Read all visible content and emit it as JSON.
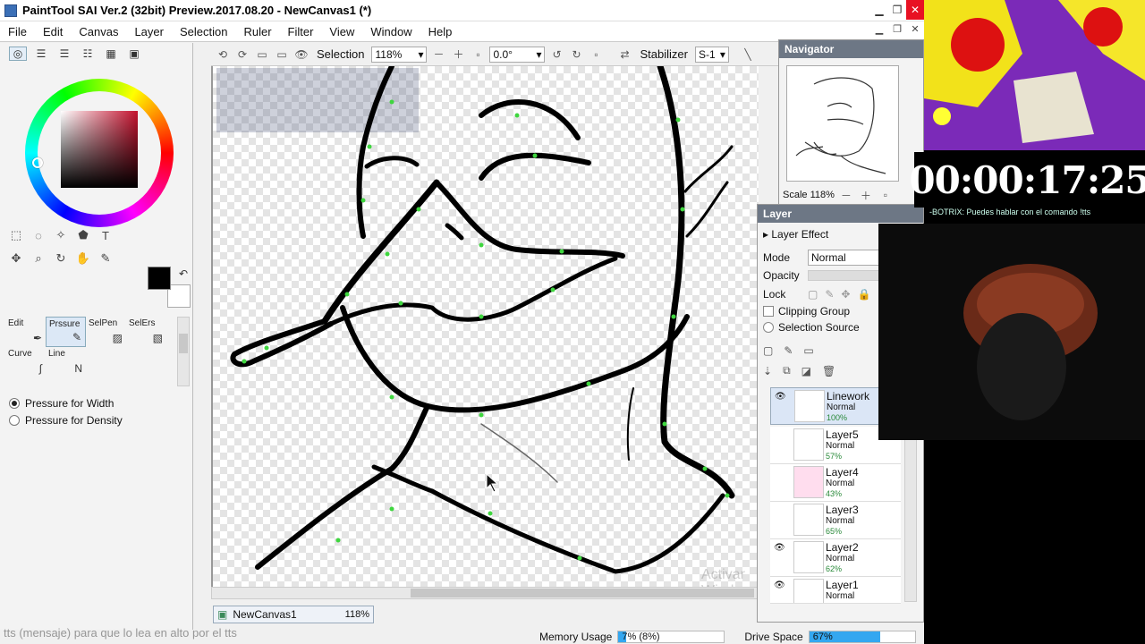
{
  "window": {
    "title": "PaintTool SAI Ver.2 (32bit) Preview.2017.08.20 - NewCanvas1 (*)"
  },
  "menu": [
    "File",
    "Edit",
    "Canvas",
    "Layer",
    "Selection",
    "Ruler",
    "Filter",
    "View",
    "Window",
    "Help"
  ],
  "toolbar": {
    "selection_label": "Selection",
    "zoom": "118%",
    "rotation": "0.0°",
    "stabilizer_label": "Stabilizer",
    "stabilizer_value": "S-1"
  },
  "brushes": [
    {
      "label": "Edit",
      "icon": "pen-icon"
    },
    {
      "label": "Prssure",
      "icon": "pressure-pen-icon"
    },
    {
      "label": "SelPen",
      "icon": "selpen-icon"
    },
    {
      "label": "SelErs",
      "icon": "selers-icon"
    },
    {
      "label": "Curve",
      "icon": "curve-icon"
    },
    {
      "label": "Line",
      "icon": "line-icon"
    }
  ],
  "pressure": {
    "width_label": "Pressure for Width",
    "density_label": "Pressure for Density",
    "selected": "width"
  },
  "canvas": {
    "tab_name": "NewCanvas1",
    "tab_zoom": "118%",
    "watermark": "Activar Windows"
  },
  "navigator": {
    "title": "Navigator",
    "scale": "Scale 118%"
  },
  "layer_panel": {
    "title": "Layer",
    "effect_label": "Layer Effect",
    "mode_label": "Mode",
    "mode_value": "Normal",
    "opacity_label": "Opacity",
    "lock_label": "Lock",
    "clipping_label": "Clipping Group",
    "selection_source_label": "Selection Source",
    "layers": [
      {
        "name": "Linework",
        "mode": "Normal",
        "opacity": "100%",
        "visible": true,
        "selected": true
      },
      {
        "name": "Layer5",
        "mode": "Normal",
        "opacity": "57%",
        "visible": false,
        "selected": false
      },
      {
        "name": "Layer4",
        "mode": "Normal",
        "opacity": "43%",
        "visible": false,
        "selected": false
      },
      {
        "name": "Layer3",
        "mode": "Normal",
        "opacity": "65%",
        "visible": false,
        "selected": false
      },
      {
        "name": "Layer2",
        "mode": "Normal",
        "opacity": "62%",
        "visible": true,
        "selected": false
      },
      {
        "name": "Layer1",
        "mode": "Normal",
        "opacity": "",
        "visible": true,
        "selected": false
      }
    ]
  },
  "status": {
    "memory_label": "Memory Usage",
    "memory_value": "7% (8%)",
    "memory_fraction": 0.07,
    "drive_label": "Drive Space",
    "drive_value": "67%",
    "drive_fraction": 0.67
  },
  "overlay": {
    "timer": "00:00:17:25",
    "chat": "-BOTRIX: Puedes hablar con el comando !tts",
    "bottom_caption": "tts (mensaje) para que lo lea en alto por el tts"
  },
  "colors": {
    "accent": "#0078d7",
    "drive_fill": "#34a7f0",
    "primary_color": "#000000",
    "secondary_color": "#ffffff"
  }
}
